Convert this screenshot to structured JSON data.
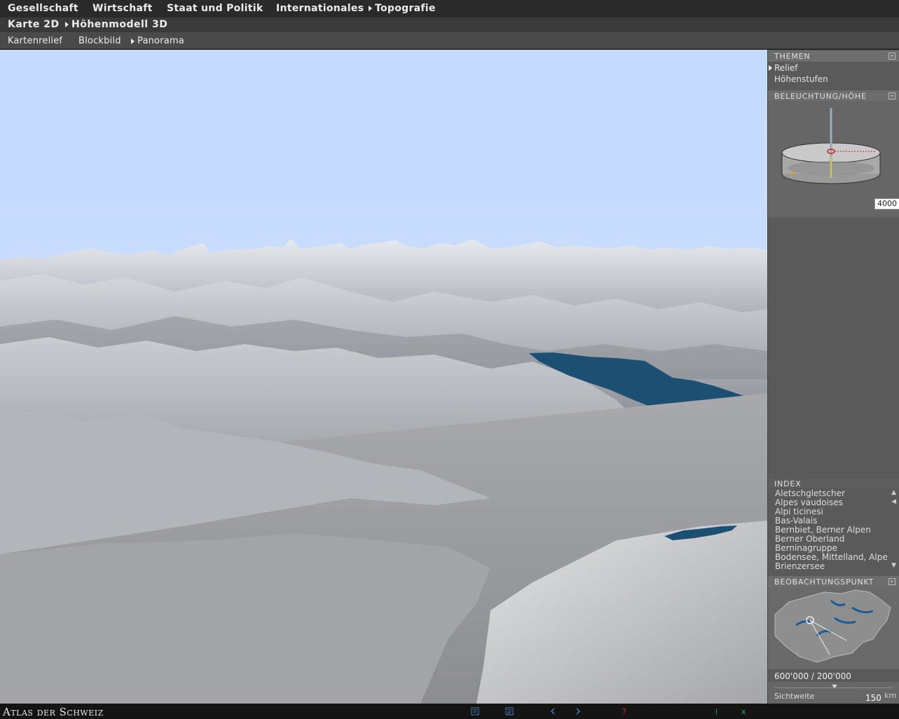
{
  "menu_primary": [
    {
      "label": "Gesellschaft",
      "arrow": false
    },
    {
      "label": "Wirtschaft",
      "arrow": false
    },
    {
      "label": "Staat und Politik",
      "arrow": false
    },
    {
      "label": "Internationales",
      "arrow": false
    },
    {
      "label": "Topografie",
      "arrow": true,
      "active": true
    }
  ],
  "menu_secondary": [
    {
      "label": "Karte 2D",
      "arrow": false
    },
    {
      "label": "Höhenmodell 3D",
      "arrow": true,
      "active": true
    }
  ],
  "menu_tertiary": [
    {
      "label": "Kartenrelief",
      "arrow": false
    },
    {
      "label": "Blockbild",
      "arrow": false
    },
    {
      "label": "Panorama",
      "arrow": true,
      "active": true
    }
  ],
  "panel": {
    "themen": {
      "title": "THEMEN",
      "items": [
        {
          "label": "Relief",
          "selected": true
        },
        {
          "label": "Höhenstufen",
          "selected": false
        }
      ]
    },
    "beleuchtung": {
      "title": "BELEUCHTUNG/HÖHE",
      "height_value": "4000"
    },
    "index": {
      "title": "INDEX",
      "items": [
        "Aletschgletscher",
        "Alpes vaudoises",
        "Alpi ticinesi",
        "Bas-Valais",
        "Bernbiet, Berner Alpen",
        "Berner Oberland",
        "Berninagruppe",
        "Bodensee, Mittelland, Alpen",
        "Brienzersee"
      ]
    },
    "beobachtungspunkt": {
      "title": "BEOBACHTUNGSPUNKT",
      "coordinates": "600'000 / 200'000",
      "sichtweite_label": "Sichtweite",
      "sichtweite_value": "150",
      "sichtweite_unit": "km"
    }
  },
  "footer": {
    "brand": "Atlas der Schweiz"
  },
  "icons": {
    "bottom": [
      "legend-icon",
      "text-icon",
      "back-icon",
      "forward-icon",
      "help-icon",
      "info-icon",
      "close-icon"
    ]
  },
  "colors": {
    "sky": "#c6dcff",
    "lake": "#1d4f73",
    "menu_bg": "#2a2a2a",
    "panel_bg": "#5a5a5a"
  }
}
